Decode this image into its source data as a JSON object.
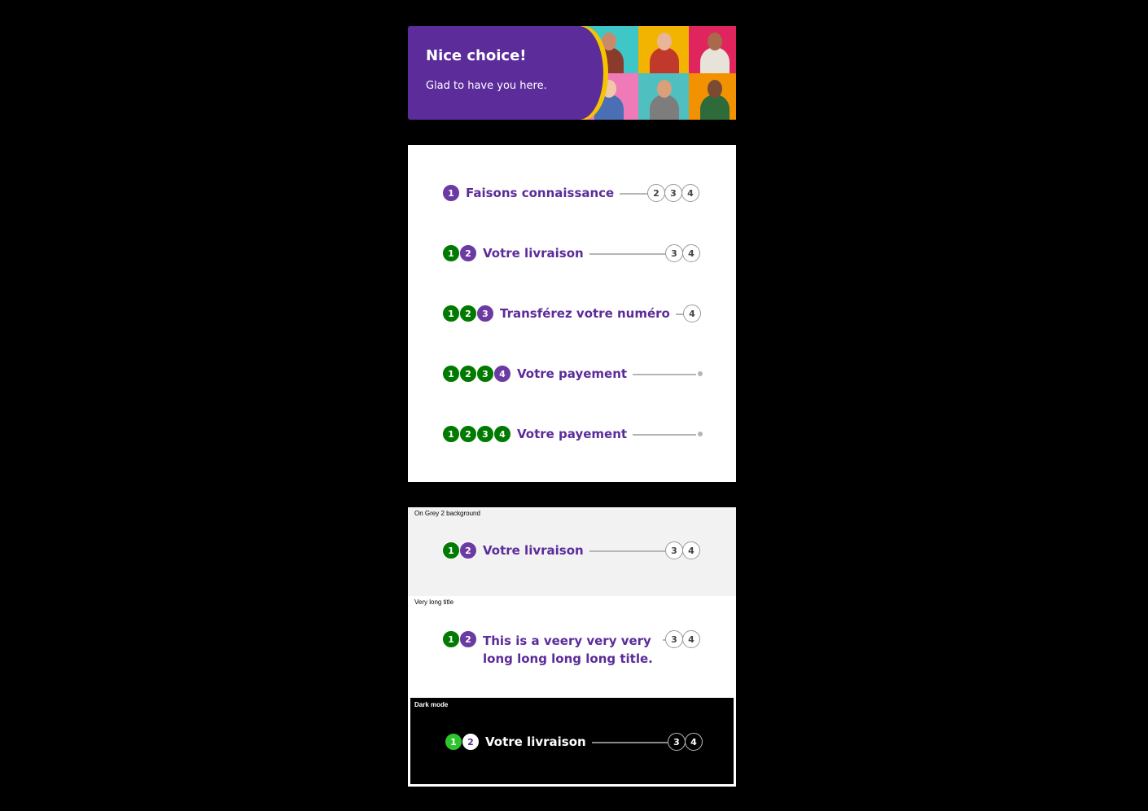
{
  "banner": {
    "title": "Nice choice!",
    "subtitle": "Glad to have you here.",
    "colors": {
      "panel": "#5b2c9a",
      "accent": "#f5c400"
    },
    "photos": [
      {
        "bg": "#3fc6c6",
        "icon": "person-photo"
      },
      {
        "bg": "#f2b400",
        "icon": "person-photo"
      },
      {
        "bg": "#e0245e",
        "icon": "person-photo"
      },
      {
        "bg": "#f07ab8",
        "icon": "couple-photo"
      },
      {
        "bg": "#4fbfc0",
        "icon": "couple-photo"
      },
      {
        "bg": "#f39200",
        "icon": "family-photo"
      }
    ]
  },
  "steppers": [
    {
      "title": "Faisons connaissance",
      "done": [],
      "active": "1",
      "todo": [
        "2",
        "3",
        "4"
      ]
    },
    {
      "title": "Votre livraison",
      "done": [
        "1"
      ],
      "active": "2",
      "todo": [
        "3",
        "4"
      ]
    },
    {
      "title": "Transférez votre numéro",
      "done": [
        "1",
        "2"
      ],
      "active": "3",
      "todo": [
        "4"
      ]
    },
    {
      "title": "Votre payement",
      "done": [
        "1",
        "2",
        "3"
      ],
      "active": "4",
      "todo": []
    },
    {
      "title": "Votre payement",
      "done": [
        "1",
        "2",
        "3",
        "4"
      ],
      "active": null,
      "todo": []
    }
  ],
  "grey_example": {
    "caption": "On Grey 2 background",
    "title": "Votre livraison",
    "done": [
      "1"
    ],
    "active": "2",
    "todo": [
      "3",
      "4"
    ]
  },
  "long_example": {
    "caption": "Very long title",
    "title": "This is a veery very very long long long long title.",
    "done": [
      "1"
    ],
    "active": "2",
    "todo": [
      "3",
      "4"
    ]
  },
  "dark_example": {
    "caption": "Dark mode",
    "title": "Votre livraison",
    "done": [
      "1"
    ],
    "active": "2",
    "todo": [
      "3",
      "4"
    ]
  },
  "colors": {
    "done": "#007a00",
    "active": "#6c3aa3",
    "title": "#5b2c9a",
    "line": "#b5b5b5",
    "dark_done": "#2ec42e"
  }
}
